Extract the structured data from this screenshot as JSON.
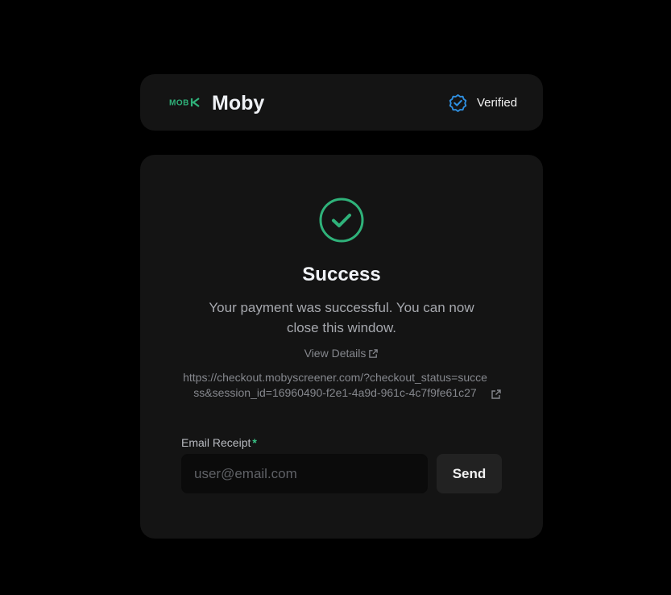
{
  "header": {
    "brand_logo_text": "MOB",
    "brand_name": "Moby",
    "verified_label": "Verified"
  },
  "status": {
    "title": "Success",
    "message": "Your payment was successful. You can now close this window.",
    "view_details_label": "View Details",
    "checkout_url": "https://checkout.mobyscreener.com/?checkout_status=success&session_id=16960490-f2e1-4a9d-961c-4c7f9fe61c27"
  },
  "receipt": {
    "label": "Email Receipt",
    "required_marker": "*",
    "email_placeholder": "user@email.com",
    "email_value": "",
    "send_label": "Send"
  },
  "colors": {
    "page_background": "#000000",
    "card_background": "#141414",
    "success_green": "#2fb27a",
    "verified_blue": "#2f8fe0",
    "required_green": "#39c486"
  },
  "icons": {
    "brand": "moby-logo-icon",
    "verified": "verified-badge-icon",
    "success": "check-circle-icon",
    "external_link": "external-link-icon"
  }
}
